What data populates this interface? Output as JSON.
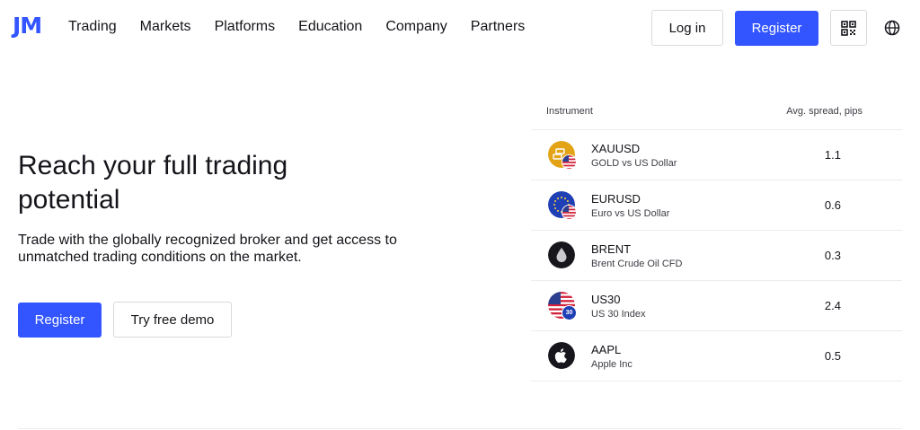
{
  "header": {
    "logo": "JM",
    "nav": [
      "Trading",
      "Markets",
      "Platforms",
      "Education",
      "Company",
      "Partners"
    ],
    "login_label": "Log in",
    "register_label": "Register",
    "qr_icon": "qr-code-icon",
    "globe_icon": "globe-icon"
  },
  "hero": {
    "title": "Reach your full trading potential",
    "subtitle": "Trade with the globally recognized broker and get access to unmatched trading conditions on the market.",
    "register_label": "Register",
    "demo_label": "Try free demo"
  },
  "instruments": {
    "col_instrument": "Instrument",
    "col_spread": "Avg. spread, pips",
    "rows": [
      {
        "symbol": "XAUUSD",
        "name": "GOLD vs US Dollar",
        "spread": "1.1",
        "icon": "gold-icon"
      },
      {
        "symbol": "EURUSD",
        "name": "Euro vs US Dollar",
        "spread": "0.6",
        "icon": "eu-flag-icon"
      },
      {
        "symbol": "BRENT",
        "name": "Brent Crude Oil CFD",
        "spread": "0.3",
        "icon": "oil-drop-icon"
      },
      {
        "symbol": "US30",
        "name": "US 30 Index",
        "spread": "2.4",
        "icon": "us-flag-icon",
        "badge": "30"
      },
      {
        "symbol": "AAPL",
        "name": "Apple Inc",
        "spread": "0.5",
        "icon": "apple-icon"
      }
    ]
  },
  "colors": {
    "accent": "#3355ff",
    "text": "#14141a",
    "border": "#d9dadf",
    "gold": "#e2a317",
    "eu_blue": "#1f3fb5"
  }
}
